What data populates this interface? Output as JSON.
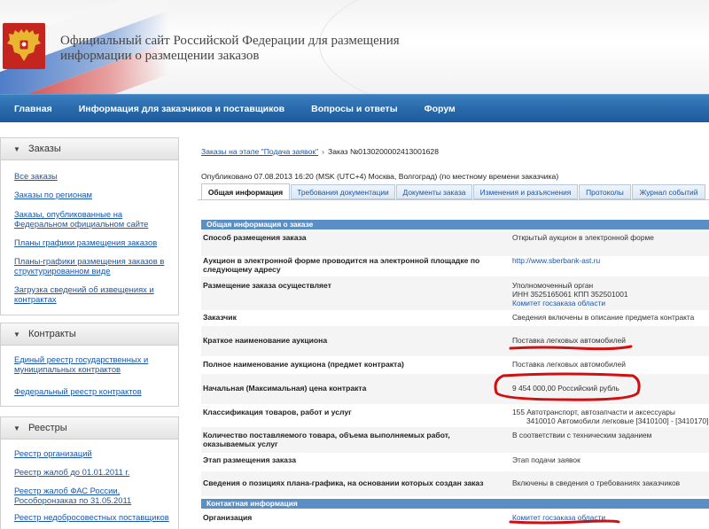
{
  "header": {
    "site_title": "Официальный сайт Российской Федерации для размещения информации о размещении заказов"
  },
  "nav": {
    "items": [
      "Главная",
      "Информация для заказчиков и поставщиков",
      "Вопросы и ответы",
      "Форум"
    ]
  },
  "sidebar": {
    "orders": {
      "title": "Заказы",
      "links": [
        "Все заказы",
        "Заказы по регионам",
        "Заказы, опубликованные на Федеральном официальном сайте",
        "Планы графики размещения заказов",
        "Планы-графики размещения заказов в структурированном виде",
        "Загрузка сведений об извещениях и контрактах"
      ]
    },
    "contracts": {
      "title": "Контракты",
      "links": [
        "Единый реестр государственных и муниципальных контрактов",
        "Федеральный реестр контрактов"
      ]
    },
    "registries": {
      "title": "Реестры",
      "links": [
        "Реестр организаций",
        "Реестр жалоб до 01.01.2011 г.",
        "Реестр жалоб ФАС России, Рособоронзаказ по 31.05.2011",
        "Реестр недобросовестных поставщиков"
      ]
    }
  },
  "breadcrumb": {
    "link": "Заказы на этапе \"Подача заявок\"",
    "separator": "›",
    "current": "Заказ №0130200002413001628"
  },
  "published": "Опубликовано 07.08.2013 16:20 (MSK (UTC+4) Москва, Волгоград) (по местному времени заказчика)",
  "tabs": [
    "Общая информация",
    "Требования документации",
    "Документы заказа",
    "Изменения и разъяснения",
    "Протоколы",
    "Журнал событий"
  ],
  "sections": {
    "general": "Общая информация о заказе",
    "contact": "Контактная информация"
  },
  "rows": {
    "method_label": "Способ размещения заказа",
    "method_value": "Открытый аукцион в электронной форме",
    "platform_label": "Аукцион в электронной форме проводится на электронной площадке по следующему адресу",
    "platform_value": "http://www.sberbank-ast.ru",
    "placement_label": "Размещение заказа осуществляет",
    "placement_line1": "Уполномоченный орган",
    "placement_line2": "ИНН 3525165061 КПП 352501001",
    "placement_line3": "Комитет госзаказа области",
    "customer_label": "Заказчик",
    "customer_value": "Сведения включены в описание предмета контракта",
    "short_name_label": "Краткое наименование аукциона",
    "short_name_value": "Поставка легковых автомобилей",
    "full_name_label": "Полное наименование аукциона (предмет контракта)",
    "full_name_value": "Поставка легковых автомобилей",
    "price_label": "Начальная (Максимальная) цена контракта",
    "price_value": "9 454 000,00 Российский рубль",
    "classification_label": "Классификация товаров, работ и услуг",
    "classification_line1": "155 Автотранспорт, автозапчасти и аксессуары",
    "classification_line2": "3410010 Автомобили легковые [3410100] - [3410170]",
    "quantity_label": "Количество поставляемого товара, объема выполняемых работ, оказываемых услуг",
    "quantity_value": "В соответствии с техническим заданием",
    "stage_label": "Этап размещения заказа",
    "stage_value": "Этап подачи заявок",
    "plan_label": "Сведения о позициях плана-графика, на основании которых создан заказ",
    "plan_value": "Включены в сведения о требованиях заказчиков",
    "org_label": "Организация",
    "org_value": "Комитет госзаказа области"
  },
  "colors": {
    "nav_bg": "#2a6aab",
    "link": "#1a56a8",
    "section_bar": "#5a8fc6",
    "emblem_bg": "#c4251e",
    "annotation_red": "#d01010"
  },
  "icons": {
    "emblem": "double-headed-eagle-icon",
    "section_toggle": "chevron-down-icon"
  }
}
